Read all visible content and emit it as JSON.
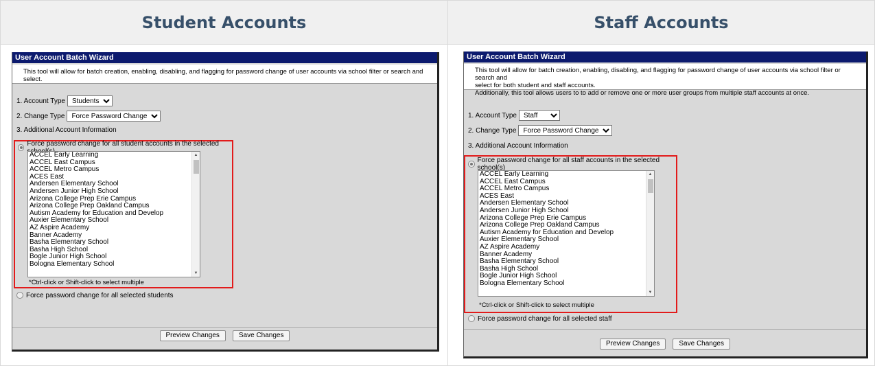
{
  "headers": {
    "student": "Student Accounts",
    "staff": "Staff Accounts"
  },
  "student": {
    "wizard_title": "User Account Batch Wizard",
    "intro": [
      "This tool will allow for batch creation, enabling, disabling, and flagging for password change of user accounts via school filter or search and select."
    ],
    "account_type_label": "1. Account Type",
    "account_type_value": "Students",
    "change_type_label": "2. Change Type",
    "change_type_value": "Force Password Change",
    "additional_label": "3. Additional Account Information",
    "option1": "Force password change for all student accounts in the selected school(s)",
    "schools": [
      "ACCEL Early Learning",
      "ACCEL East Campus",
      "ACCEL Metro Campus",
      "ACES East",
      "Andersen Elementary School",
      "Andersen Junior High School",
      "Arizona College Prep Erie Campus",
      "Arizona College Prep Oakland Campus",
      "Autism Academy for Education and Develop",
      "Auxier Elementary School",
      "AZ Aspire Academy",
      "Banner Academy",
      "Basha Elementary School",
      "Basha High School",
      "Bogle Junior High School",
      "Bologna Elementary School"
    ],
    "hint": "*Ctrl-click or Shift-click to select multiple",
    "option2": "Force password change for all selected students",
    "preview": "Preview Changes",
    "save": "Save Changes"
  },
  "staff": {
    "wizard_title": "User Account Batch Wizard",
    "intro": [
      "This tool will allow for batch creation, enabling, disabling, and flagging for password change of user accounts via school filter or search and",
      "select for both student and staff accounts.",
      "Additionally, this tool allows users to to add or remove one or more user groups from multiple staff accounts at once."
    ],
    "account_type_label": "1. Account Type",
    "account_type_value": "Staff",
    "change_type_label": "2. Change Type",
    "change_type_value": "Force Password Change",
    "additional_label": "3. Additional Account Information",
    "option1": "Force password change for all staff accounts in the selected school(s)",
    "schools": [
      "ACCEL Early Learning",
      "ACCEL East Campus",
      "ACCEL Metro Campus",
      "ACES East",
      "Andersen Elementary School",
      "Andersen Junior High School",
      "Arizona College Prep Erie Campus",
      "Arizona College Prep Oakland Campus",
      "Autism Academy for Education and Develop",
      "Auxier Elementary School",
      "AZ Aspire Academy",
      "Banner Academy",
      "Basha Elementary School",
      "Basha High School",
      "Bogle Junior High School",
      "Bologna Elementary School"
    ],
    "hint": "*Ctrl-click or Shift-click to select multiple",
    "option2": "Force password change for all selected staff",
    "preview": "Preview Changes",
    "save": "Save Changes"
  },
  "colors": {
    "title_bar": "#0c1a6e",
    "highlight": "#e21b1b",
    "header_text": "#37506a"
  },
  "icons": {
    "scroll_up": "triangle-up",
    "scroll_down": "triangle-down",
    "dropdown": "triangle-down"
  }
}
